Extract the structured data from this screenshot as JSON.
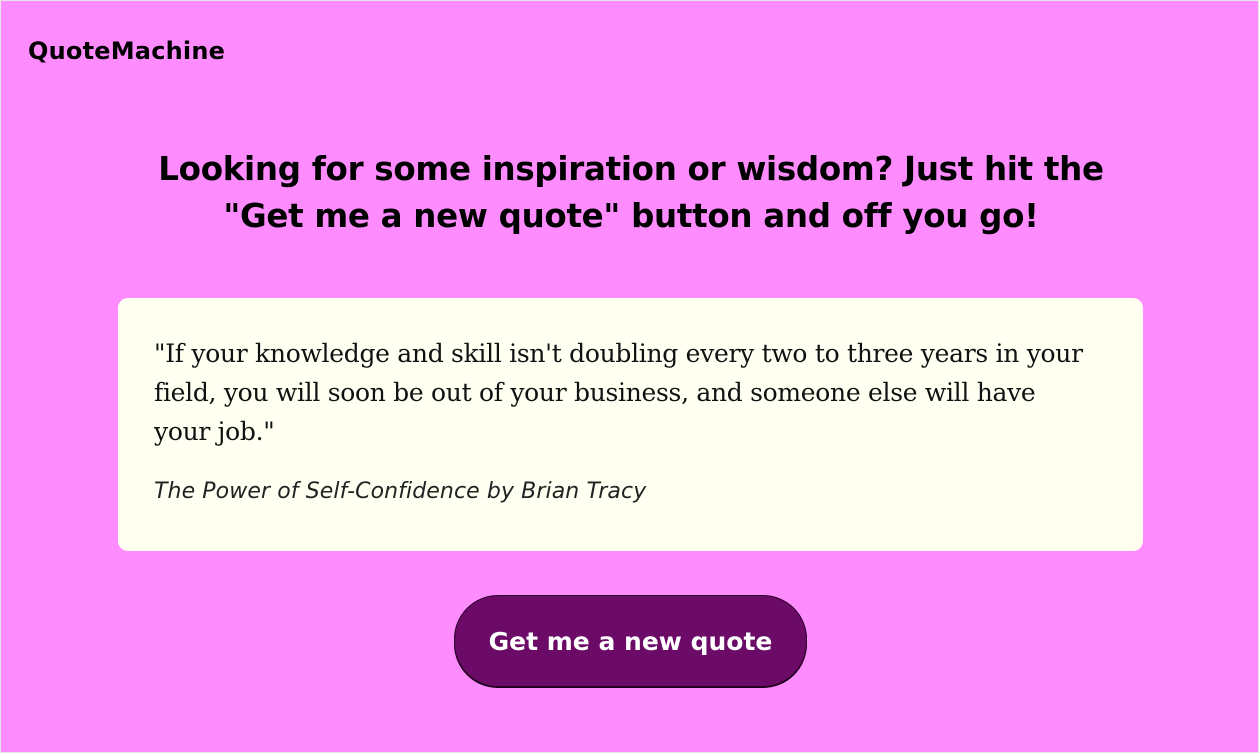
{
  "header": {
    "logo_text": "QuoteMachine"
  },
  "main": {
    "headline": "Looking for some inspiration or wisdom? Just hit the \"Get me a new quote\" button and off you go!",
    "quote": {
      "text": "\"If your knowledge and skill isn't doubling every two to three years in your field, you will soon be out of your business, and someone else will have your job.\"",
      "source": "The Power of Self-Confidence by Brian Tracy"
    },
    "button_label": "Get me a new quote"
  },
  "colors": {
    "page_background": "#ff8cff",
    "card_background": "#fffff2",
    "button_background": "#6b0a67",
    "button_text": "#ffffff"
  }
}
